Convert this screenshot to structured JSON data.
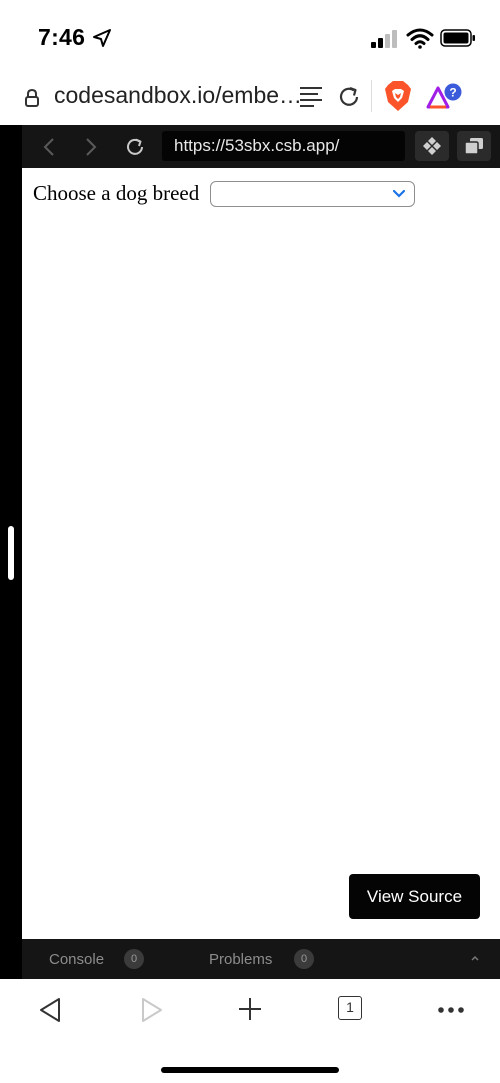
{
  "status_bar": {
    "time": "7:46",
    "icons": [
      "location-arrow-icon",
      "cellular-signal-icon",
      "wifi-icon",
      "battery-icon"
    ]
  },
  "browser": {
    "url": "codesandbox.io/embe…",
    "icons": [
      "lock-icon",
      "reader-mode-icon",
      "reload-icon",
      "brave-shield-icon",
      "brave-rewards-icon"
    ]
  },
  "embed": {
    "address": "https://53sbx.csb.app/",
    "preview": {
      "label": "Choose a dog breed",
      "select_value": ""
    },
    "view_source_label": "View Source",
    "console": {
      "console_label": "Console",
      "console_count": "0",
      "problems_label": "Problems",
      "problems_count": "0"
    }
  },
  "bottom_toolbar": {
    "tab_count": "1",
    "icons": [
      "back-icon",
      "forward-icon",
      "add-tab-icon",
      "tabs-icon",
      "more-icon"
    ]
  },
  "colors": {
    "embed_background": "#151515",
    "button_background": "#040404",
    "brave_orange": "#fb542b",
    "select_chevron": "#1a73e8"
  }
}
